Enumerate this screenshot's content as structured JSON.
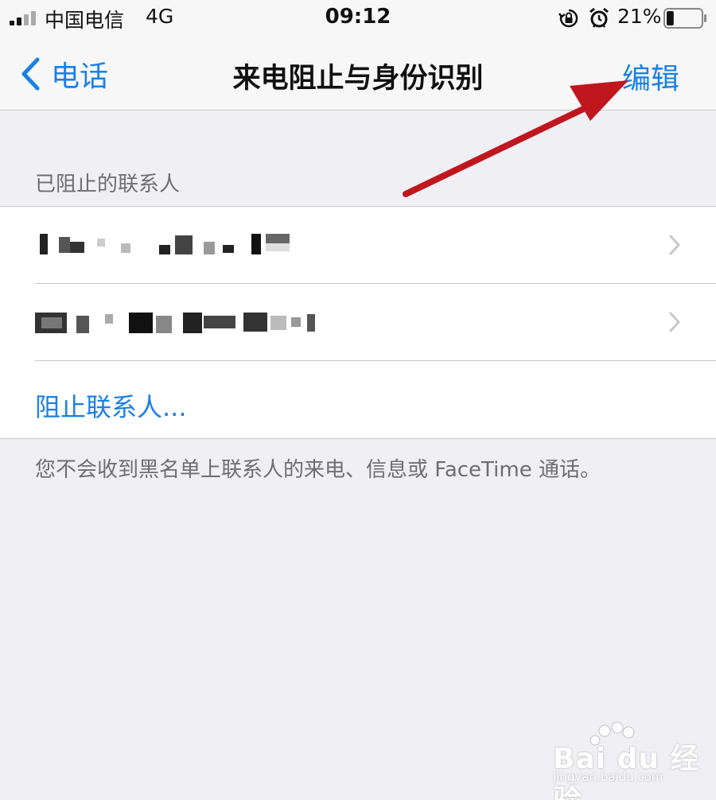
{
  "status_bar": {
    "carrier": "中国电信",
    "network": "4G",
    "time": "09:12",
    "battery_percent": "21%",
    "battery_level": 0.21
  },
  "nav": {
    "back_label": "电话",
    "title": "来电阻止与身份识别",
    "edit_label": "编辑"
  },
  "blocked_section": {
    "header": "已阻止的联系人",
    "contacts": [
      {
        "value": "",
        "redacted": true
      },
      {
        "value": "",
        "redacted": true
      }
    ],
    "block_contact_label": "阻止联系人...",
    "footer": "您不会收到黑名单上联系人的来电、信息或 FaceTime 通话。"
  },
  "watermark": {
    "brand": "Bai du 经验",
    "url": "jingyan.baidu.com"
  },
  "colors": {
    "accent": "#1a80e6",
    "annotation": "#c0161e",
    "background": "#efeff4"
  }
}
